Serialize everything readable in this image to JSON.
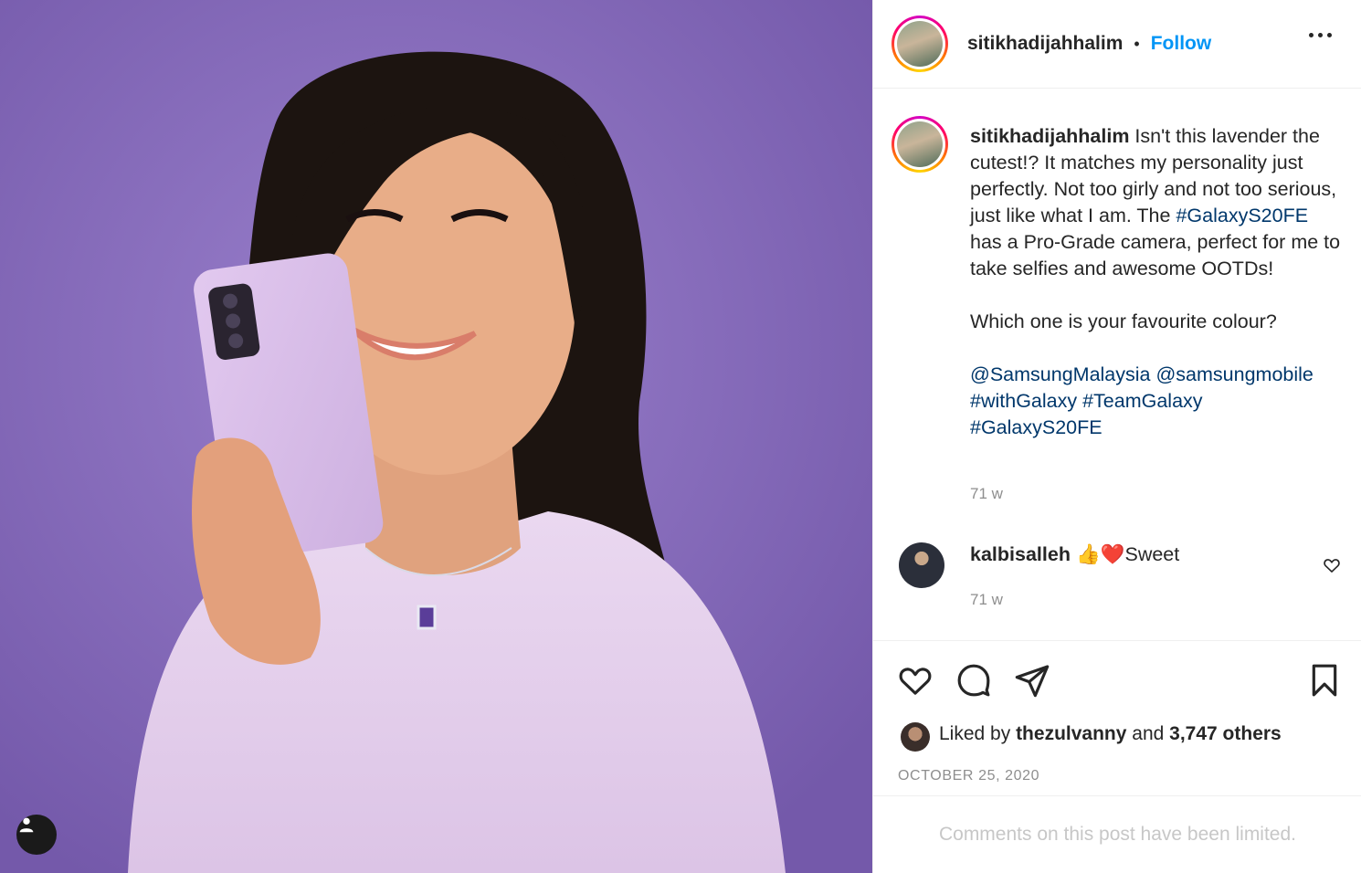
{
  "post": {
    "username": "sitikhadijahhalim",
    "follow_label": "Follow",
    "dot": "•",
    "caption": {
      "part1": "Isn't this lavender the cutest!? It matches my personality just perfectly. Not too girly and not too serious, just like what I am. The ",
      "hashtag1": "#GalaxyS20FE",
      "part2": " has a Pro-Grade camera, perfect for me to take selfies and awesome OOTDs!",
      "question": "Which one is your favourite colour?",
      "mention1": "@SamsungMalaysia",
      "mention2": "@samsungmobile",
      "hashtag2": "#withGalaxy",
      "hashtag3": "#TeamGalaxy",
      "hashtag4": "#GalaxyS20FE"
    },
    "caption_time": "71 w",
    "comment": {
      "username": "kalbisalleh",
      "text": "👍❤️Sweet",
      "time": "71 w"
    },
    "likes": {
      "prefix": "Liked by",
      "user": "thezulvanny",
      "middle": "and",
      "count": "3,747 others"
    },
    "date": "OCTOBER 25, 2020",
    "comments_limited": "Comments on this post have been limited."
  },
  "icons": {
    "more": "more-options-icon",
    "like": "heart-icon",
    "comment": "comment-icon",
    "share": "share-icon",
    "save": "bookmark-icon",
    "tag": "user-tag-icon"
  },
  "colors": {
    "accent": "#0095f6",
    "hashtag": "#00376b",
    "muted": "#8e8e8e",
    "photo_background": "#8168b8"
  }
}
